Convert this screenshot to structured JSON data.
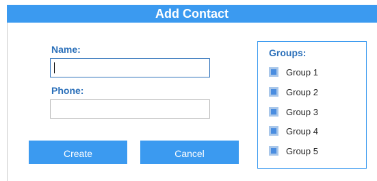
{
  "dialog": {
    "title": "Add Contact",
    "name_label": "Name:",
    "name_value": "",
    "phone_label": "Phone:",
    "phone_value": "",
    "create_label": "Create",
    "cancel_label": "Cancel"
  },
  "groups": {
    "title": "Groups:",
    "items": [
      {
        "label": "Group 1",
        "checked": false
      },
      {
        "label": "Group 2",
        "checked": false
      },
      {
        "label": "Group 3",
        "checked": false
      },
      {
        "label": "Group 4",
        "checked": false
      },
      {
        "label": "Group 5",
        "checked": false
      }
    ]
  },
  "colors": {
    "accent": "#3b9af0",
    "label": "#2a6fb9"
  }
}
